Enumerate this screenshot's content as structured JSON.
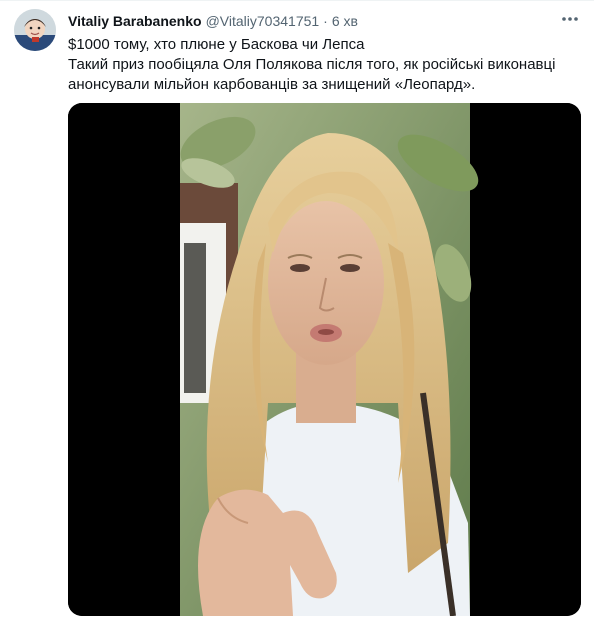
{
  "tweet": {
    "author": {
      "display_name": "Vitaliy Barabanenko",
      "handle": "@Vitaliy70341751"
    },
    "separator": "·",
    "time": "6 хв",
    "text_lines": [
      "$1000 тому, хто плюне у Баскова чи Лепса",
      "Такий приз пообіцяла Оля Полякова після того, як російські виконавці",
      "анонсували мільйон карбованців за знищений «Леопард»."
    ],
    "more_icon": "more-horizontal-icon",
    "media_type": "video"
  }
}
